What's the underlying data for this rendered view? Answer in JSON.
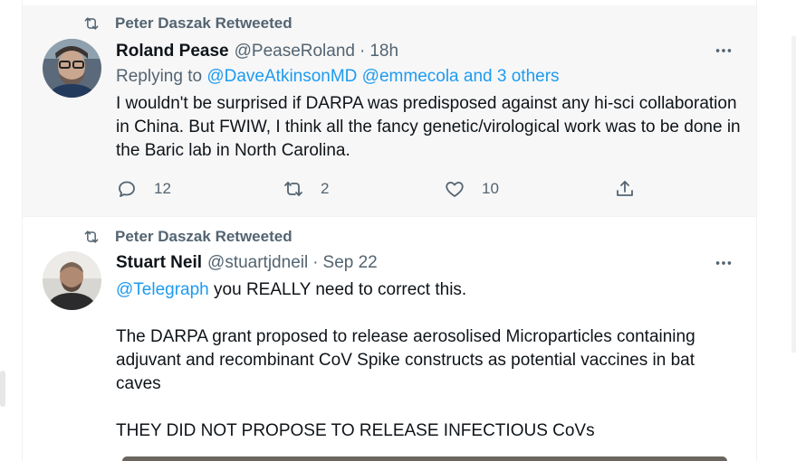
{
  "tweets": [
    {
      "retweeted_by": "Peter Daszak Retweeted",
      "display_name": "Roland Pease",
      "handle": "@PeaseRoland",
      "separator": "·",
      "time": "18h",
      "replying_to_label": "Replying to",
      "replying_to_users": "@DaveAtkinsonMD @emmecola",
      "replying_to_others": "and 3 others",
      "text": "I wouldn't be surprised if DARPA was predisposed against any hi-sci collaboration in China. But FWIW, I think all the fancy genetic/virological work was to be done in the Baric lab in North Carolina.",
      "replies": "12",
      "retweets": "2",
      "likes": "10",
      "icons": {
        "retweeted": "retweet-icon",
        "more": "more-horizontal-icon",
        "reply": "reply-icon",
        "retweet": "retweet-icon",
        "like": "heart-icon",
        "share": "share-icon"
      }
    },
    {
      "retweeted_by": "Peter Daszak Retweeted",
      "display_name": "Stuart Neil",
      "handle": "@stuartjdneil",
      "separator": "·",
      "time": "Sep 22",
      "mention": "@Telegraph",
      "text_line1": " you REALLY need to correct this.",
      "text_para2": "The DARPA grant proposed to release aerosolised Microparticles containing adjuvant and recombinant CoV Spike constructs as potential vaccines in bat caves",
      "text_para3": "THEY DID NOT PROPOSE TO RELEASE INFECTIOUS CoVs"
    }
  ],
  "colors": {
    "link": "#1d9bf0",
    "secondary_text": "#536471",
    "primary_text": "#0f1419",
    "hover_bg": "#f7f7f7"
  }
}
